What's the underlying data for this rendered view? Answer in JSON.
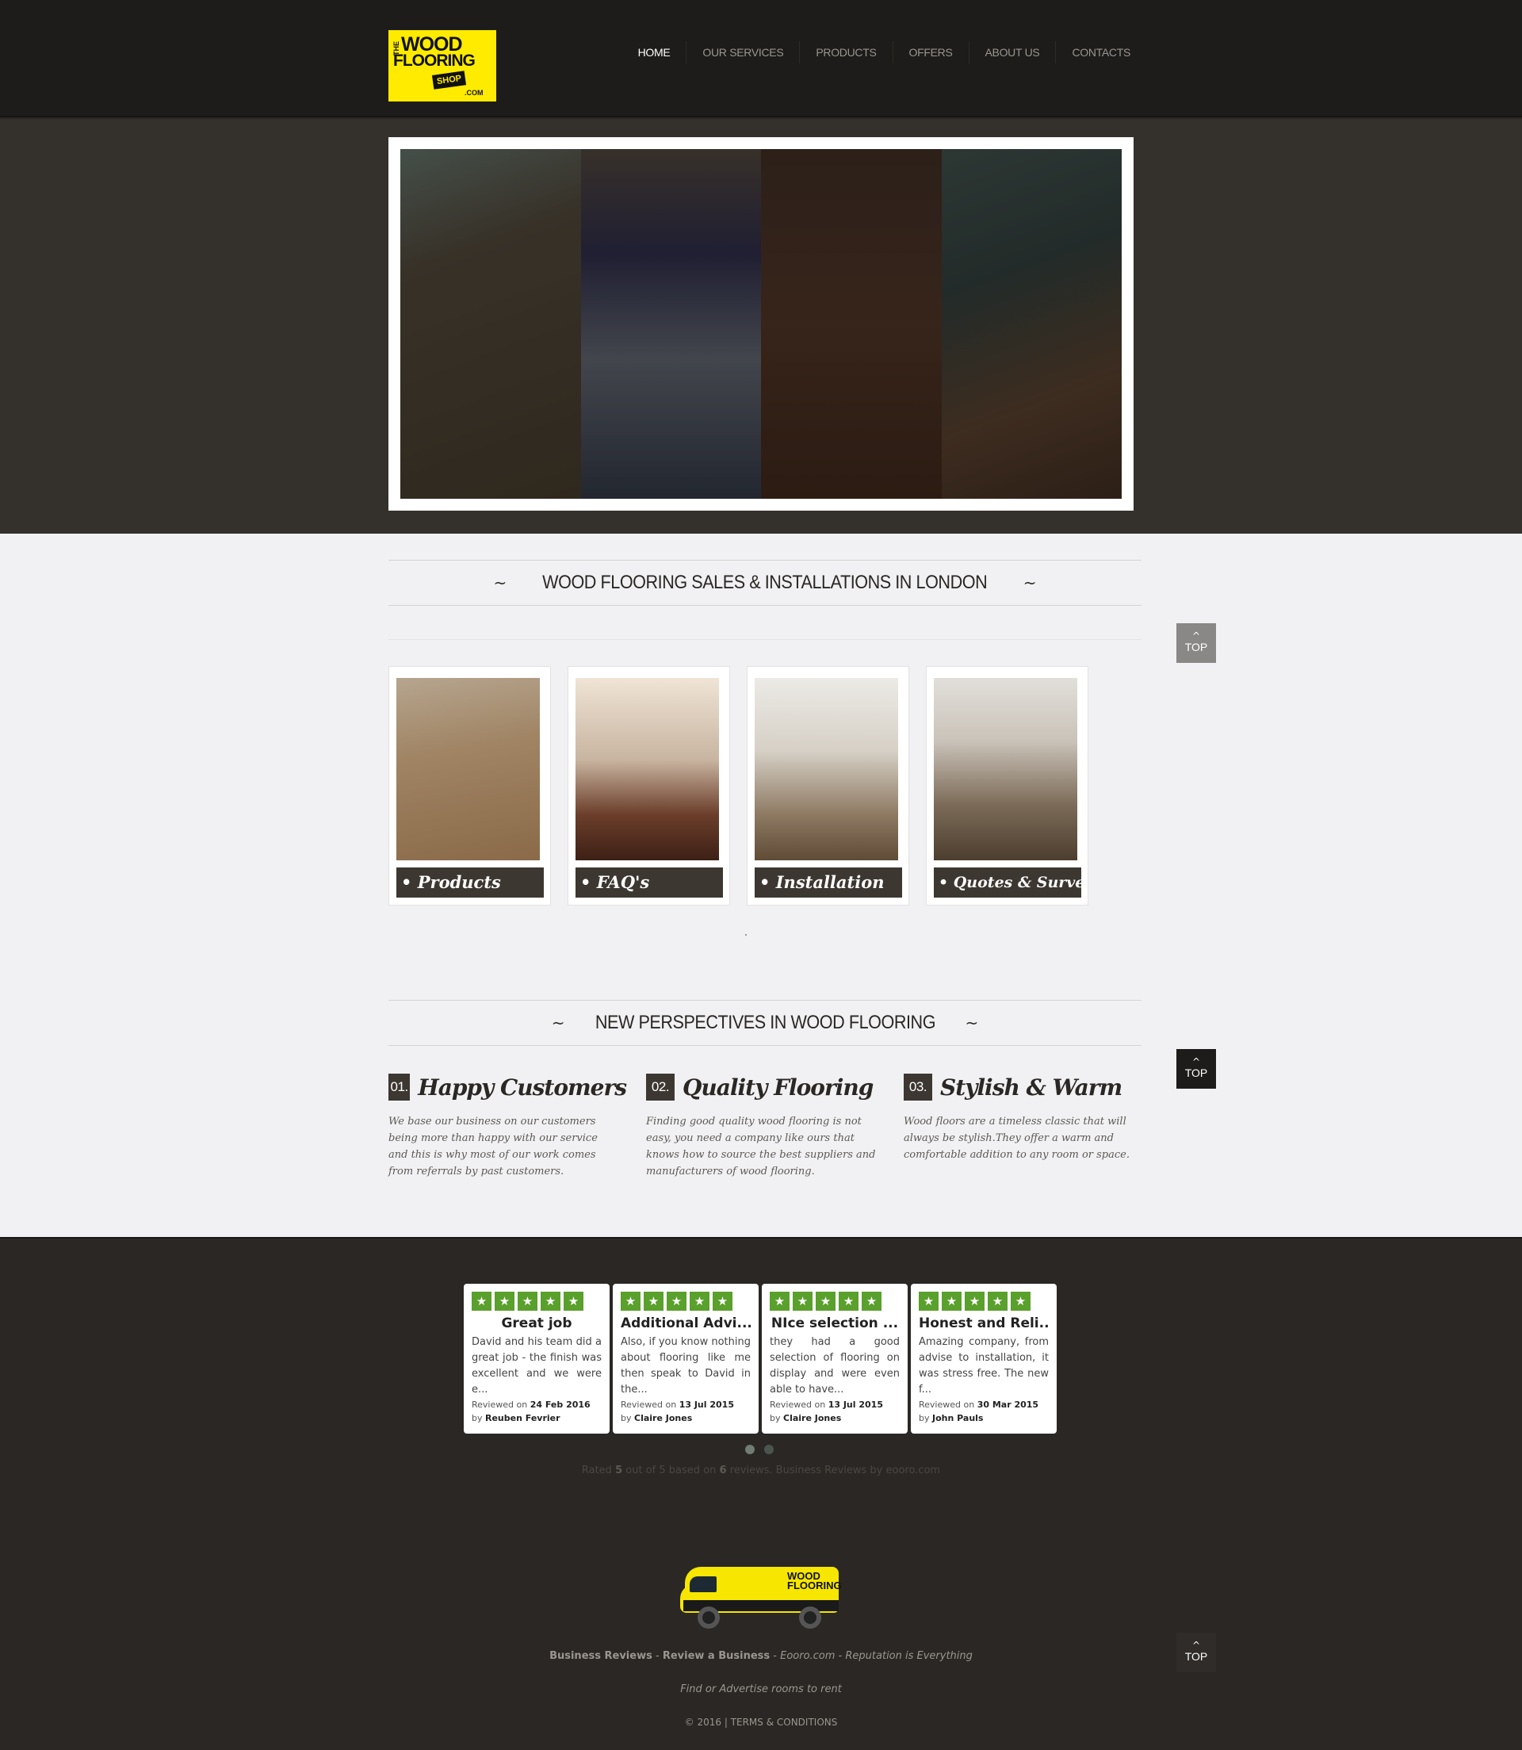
{
  "header": {
    "logo": {
      "the": "THE",
      "wood": "WOOD",
      "flooring": "FLOORING",
      "shop": "SHOP",
      "com": ".COM"
    },
    "nav": [
      {
        "label": "HOME"
      },
      {
        "label": "OUR SERVICES"
      },
      {
        "label": "PRODUCTS"
      },
      {
        "label": "OFFERS"
      },
      {
        "label": "ABOUT US"
      },
      {
        "label": "CONTACTS"
      }
    ]
  },
  "sections": {
    "sales_title": "WOOD FLOORING SALES & INSTALLATIONS IN LONDON",
    "perspectives_title": "NEW PERSPECTIVES IN WOOD FLOORING",
    "swirl_left": "~",
    "swirl_right": "~"
  },
  "cards": [
    {
      "label": "• Products"
    },
    {
      "label": "• FAQ's"
    },
    {
      "label": "• Installation"
    },
    {
      "label": "• Quotes & Surveys"
    }
  ],
  "features": [
    {
      "num": "01.",
      "title": "Happy Customers",
      "desc": "We base our business on our customers being more than happy with our service and this is why most of our work comes from referrals by past customers."
    },
    {
      "num": "02.",
      "title": "Quality Flooring",
      "desc": "Finding good quality wood flooring is not easy, you need a company like ours that knows how to source the best suppliers and manufacturers of wood flooring."
    },
    {
      "num": "03.",
      "title": "Stylish & Warm",
      "desc": "Wood floors are a timeless classic that will always be stylish.They offer a warm and comfortable addition to any room or space."
    }
  ],
  "top_button": {
    "label": "TOP",
    "chevron": "^"
  },
  "reviews": [
    {
      "title": "Great job",
      "body": "David and his team did a great job - the finish was excellent and we were e...",
      "reviewed_label": "Reviewed on",
      "date": "24 Feb 2016",
      "by_label": "by",
      "author": "Reuben Fevrier"
    },
    {
      "title": "Additional Advi...",
      "body": "Also, if you know nothing about flooring like me then speak to David in the...",
      "reviewed_label": "Reviewed on",
      "date": "13 Jul 2015",
      "by_label": "by",
      "author": "Claire Jones"
    },
    {
      "title": "NIce selection ...",
      "body": "they had a good selection of flooring on display and were even able to have...",
      "reviewed_label": "Reviewed on",
      "date": "13 Jul 2015",
      "by_label": "by",
      "author": "Claire Jones"
    },
    {
      "title": "Honest and Reli...",
      "body": "Amazing company, from advise to installation, it was stress free. The new f...",
      "reviewed_label": "Reviewed on",
      "date": "30 Mar 2015",
      "by_label": "by",
      "author": "John Pauls"
    }
  ],
  "star_glyph": "★",
  "rating": {
    "prefix": "Rated",
    "score": "5",
    "mid": "out of 5 based on",
    "count": "6",
    "suffix": "reviews. Business Reviews by eooro.com"
  },
  "van_logo": {
    "line1": "WOOD",
    "line2": "FLOORING"
  },
  "footer": {
    "line1_a": "Business Reviews",
    "line1_sep1": " - ",
    "line1_b": "Review a Business",
    "line1_sep2": " - ",
    "line1_c": "Eooro.com - Reputation is Everything",
    "line2": "Find or Advertise rooms to rent",
    "copyright": "© 2016",
    "terms": "| TERMS & CONDITIONS"
  },
  "colors": {
    "accent_yellow": "#ffeb00",
    "star_green": "#5aa02c",
    "dark_bg": "#2a2724",
    "light_bg": "#f1f1f3"
  }
}
